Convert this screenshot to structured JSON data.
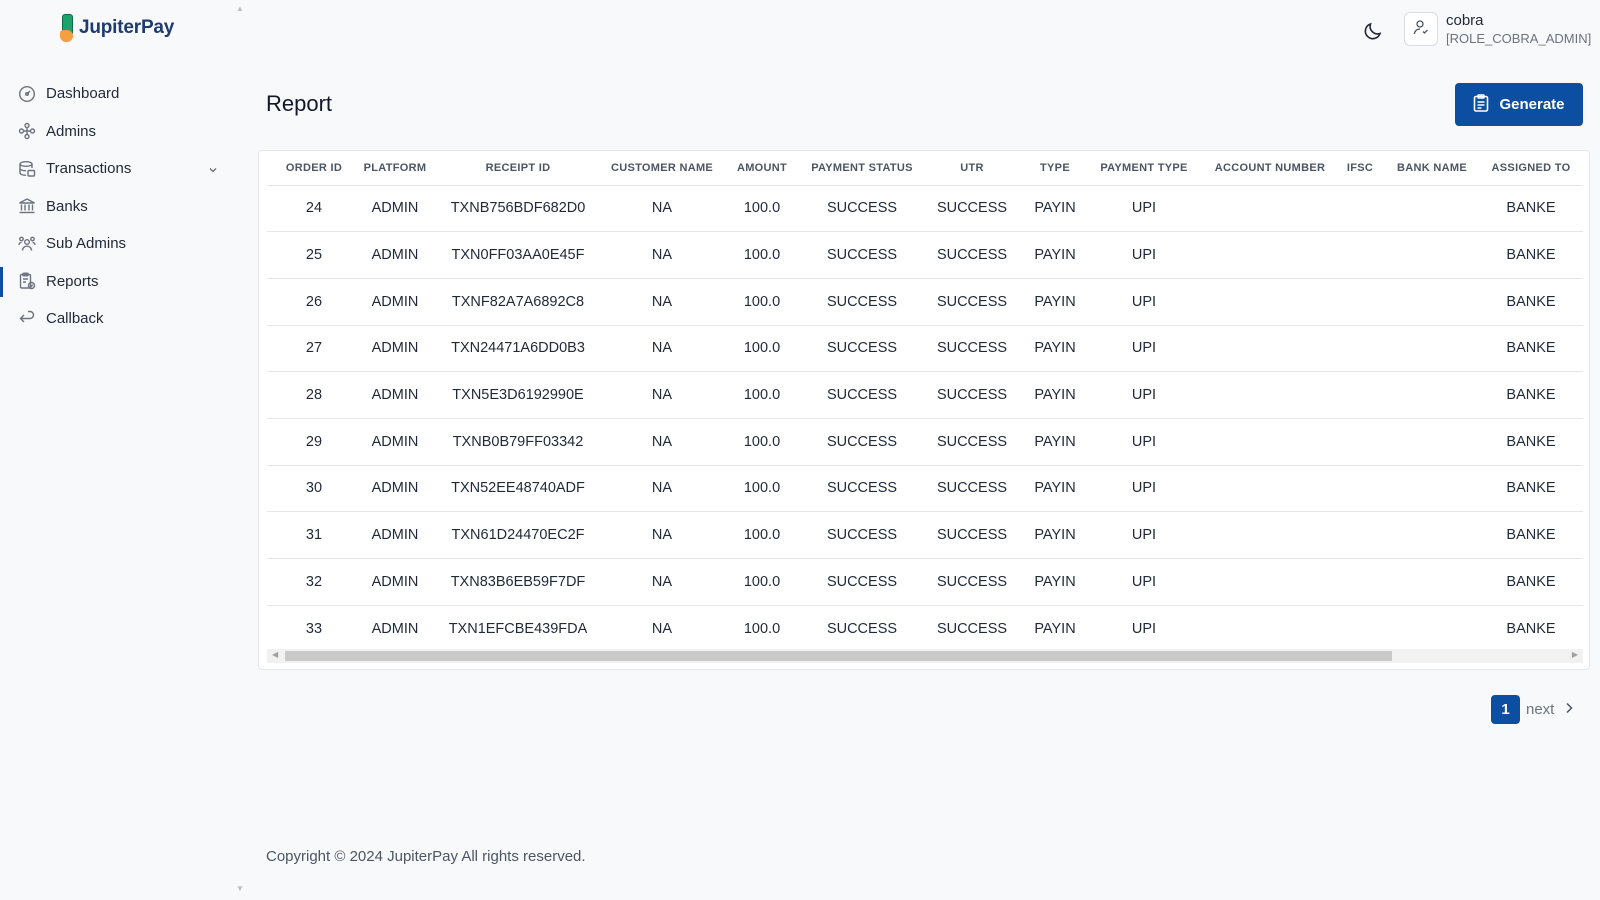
{
  "brand": {
    "name": "JupiterPay"
  },
  "sidebar": {
    "items": [
      {
        "label": "Dashboard",
        "icon": "dashboard-gauge-icon"
      },
      {
        "label": "Admins",
        "icon": "admins-network-icon"
      },
      {
        "label": "Transactions",
        "icon": "transactions-database-icon",
        "expandable": true
      },
      {
        "label": "Banks",
        "icon": "bank-icon"
      },
      {
        "label": "Sub Admins",
        "icon": "users-group-icon"
      },
      {
        "label": "Reports",
        "icon": "report-clipboard-icon",
        "active": true
      },
      {
        "label": "Callback",
        "icon": "callback-return-icon"
      }
    ]
  },
  "header": {
    "theme_icon": "moon-icon",
    "user": {
      "name": "cobra",
      "role": "[ROLE_COBRA_ADMIN]"
    }
  },
  "page": {
    "title": "Report",
    "generate_label": "Generate"
  },
  "table": {
    "columns": [
      "ORDER ID",
      "PLATFORM",
      "RECEIPT ID",
      "CUSTOMER NAME",
      "AMOUNT",
      "PAYMENT STATUS",
      "UTR",
      "TYPE",
      "PAYMENT TYPE",
      "ACCOUNT NUMBER",
      "IFSC",
      "BANK NAME",
      "ASSIGNED TO"
    ],
    "rows": [
      [
        "24",
        "ADMIN",
        "TXNB756BDF682D0",
        "NA",
        "100.0",
        "SUCCESS",
        "SUCCESS",
        "PAYIN",
        "UPI",
        "",
        "",
        "",
        "BANKE"
      ],
      [
        "25",
        "ADMIN",
        "TXN0FF03AA0E45F",
        "NA",
        "100.0",
        "SUCCESS",
        "SUCCESS",
        "PAYIN",
        "UPI",
        "",
        "",
        "",
        "BANKE"
      ],
      [
        "26",
        "ADMIN",
        "TXNF82A7A6892C8",
        "NA",
        "100.0",
        "SUCCESS",
        "SUCCESS",
        "PAYIN",
        "UPI",
        "",
        "",
        "",
        "BANKE"
      ],
      [
        "27",
        "ADMIN",
        "TXN24471A6DD0B3",
        "NA",
        "100.0",
        "SUCCESS",
        "SUCCESS",
        "PAYIN",
        "UPI",
        "",
        "",
        "",
        "BANKE"
      ],
      [
        "28",
        "ADMIN",
        "TXN5E3D6192990E",
        "NA",
        "100.0",
        "SUCCESS",
        "SUCCESS",
        "PAYIN",
        "UPI",
        "",
        "",
        "",
        "BANKE"
      ],
      [
        "29",
        "ADMIN",
        "TXNB0B79FF03342",
        "NA",
        "100.0",
        "SUCCESS",
        "SUCCESS",
        "PAYIN",
        "UPI",
        "",
        "",
        "",
        "BANKE"
      ],
      [
        "30",
        "ADMIN",
        "TXN52EE48740ADF",
        "NA",
        "100.0",
        "SUCCESS",
        "SUCCESS",
        "PAYIN",
        "UPI",
        "",
        "",
        "",
        "BANKE"
      ],
      [
        "31",
        "ADMIN",
        "TXN61D24470EC2F",
        "NA",
        "100.0",
        "SUCCESS",
        "SUCCESS",
        "PAYIN",
        "UPI",
        "",
        "",
        "",
        "BANKE"
      ],
      [
        "32",
        "ADMIN",
        "TXN83B6EB59F7DF",
        "NA",
        "100.0",
        "SUCCESS",
        "SUCCESS",
        "PAYIN",
        "UPI",
        "",
        "",
        "",
        "BANKE"
      ],
      [
        "33",
        "ADMIN",
        "TXN1EFCBE439FDA",
        "NA",
        "100.0",
        "SUCCESS",
        "SUCCESS",
        "PAYIN",
        "UPI",
        "",
        "",
        "",
        "BANKE"
      ]
    ]
  },
  "pagination": {
    "current_page": "1",
    "next_label": "next"
  },
  "footer": {
    "copyright": "Copyright © 2024 JupiterPay All rights reserved."
  },
  "colors": {
    "accent": "#0b4ea2",
    "background": "#f8f9fb",
    "text": "#1f2937"
  }
}
